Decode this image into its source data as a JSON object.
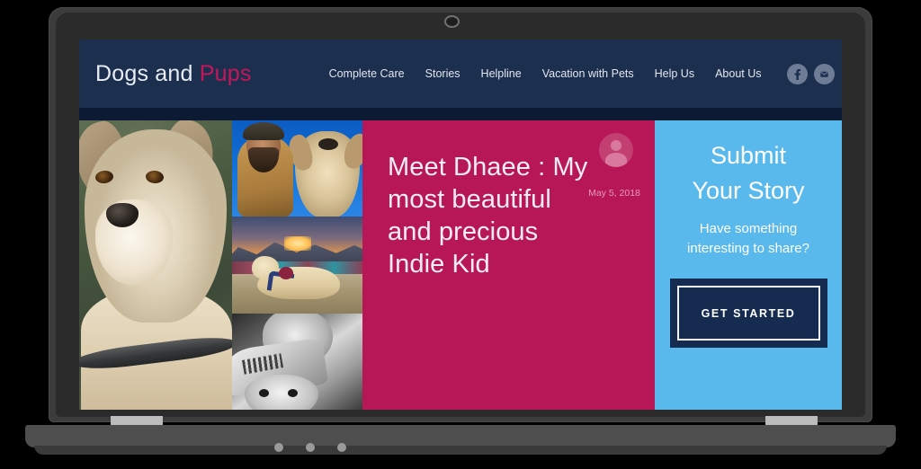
{
  "site": {
    "brand_part1": "Dogs and ",
    "brand_part2": "Pups"
  },
  "nav": {
    "items": [
      {
        "label": "Complete Care"
      },
      {
        "label": "Stories"
      },
      {
        "label": "Helpline"
      },
      {
        "label": "Vacation with Pets"
      },
      {
        "label": "Help Us"
      },
      {
        "label": "About Us"
      }
    ]
  },
  "social": {
    "facebook": "facebook-icon",
    "email": "email-icon"
  },
  "hero": {
    "headline": "Meet Dhaee : My most beautiful and precious Indie Kid",
    "author": "",
    "date": "May 5, 2018",
    "avatar": "user-avatar-placeholder"
  },
  "cta": {
    "title_line1": "Submit",
    "title_line2": "Your Story",
    "subtitle": "Have something interesting to share?",
    "button_label": "GET STARTED"
  },
  "colors": {
    "header_navy": "#1c2f4f",
    "deep_navy": "#0d1a33",
    "magenta": "#b81757",
    "light_blue": "#59b9ed",
    "button_navy": "#152b50"
  },
  "device": {
    "webcam": "webcam-icon",
    "indicator_dots": 3
  }
}
